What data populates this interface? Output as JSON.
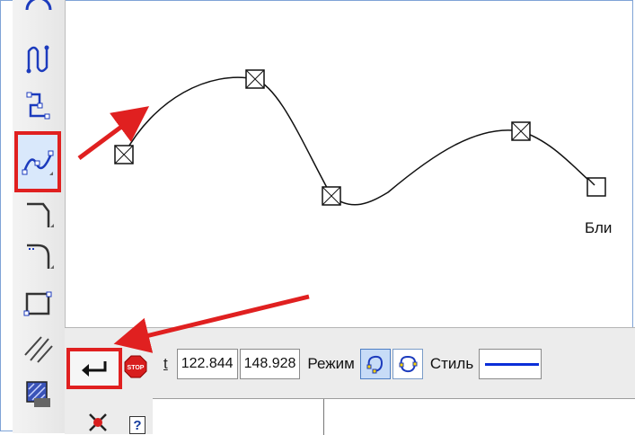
{
  "canvas": {
    "point_label": "Бли"
  },
  "toolbar": {
    "tools": [
      {
        "name": "circle-tool-icon"
      },
      {
        "name": "nurbs-tool-icon"
      },
      {
        "name": "polyline-tool-icon"
      },
      {
        "name": "bezier-tool-icon"
      },
      {
        "name": "chamfer-tool-icon"
      },
      {
        "name": "fillet-tool-icon"
      },
      {
        "name": "rectangle-tool-icon"
      },
      {
        "name": "hatch-lines-tool-icon"
      },
      {
        "name": "fill-tool-icon"
      }
    ]
  },
  "properties": {
    "param_letter": "t",
    "field_1": "122.844",
    "field_2": "148.928",
    "mode_label": "Режим",
    "style_label": "Стиль"
  },
  "colors": {
    "highlight": "#e02020",
    "style_line": "#0a2ed8",
    "accent": "#4d7ec4"
  }
}
